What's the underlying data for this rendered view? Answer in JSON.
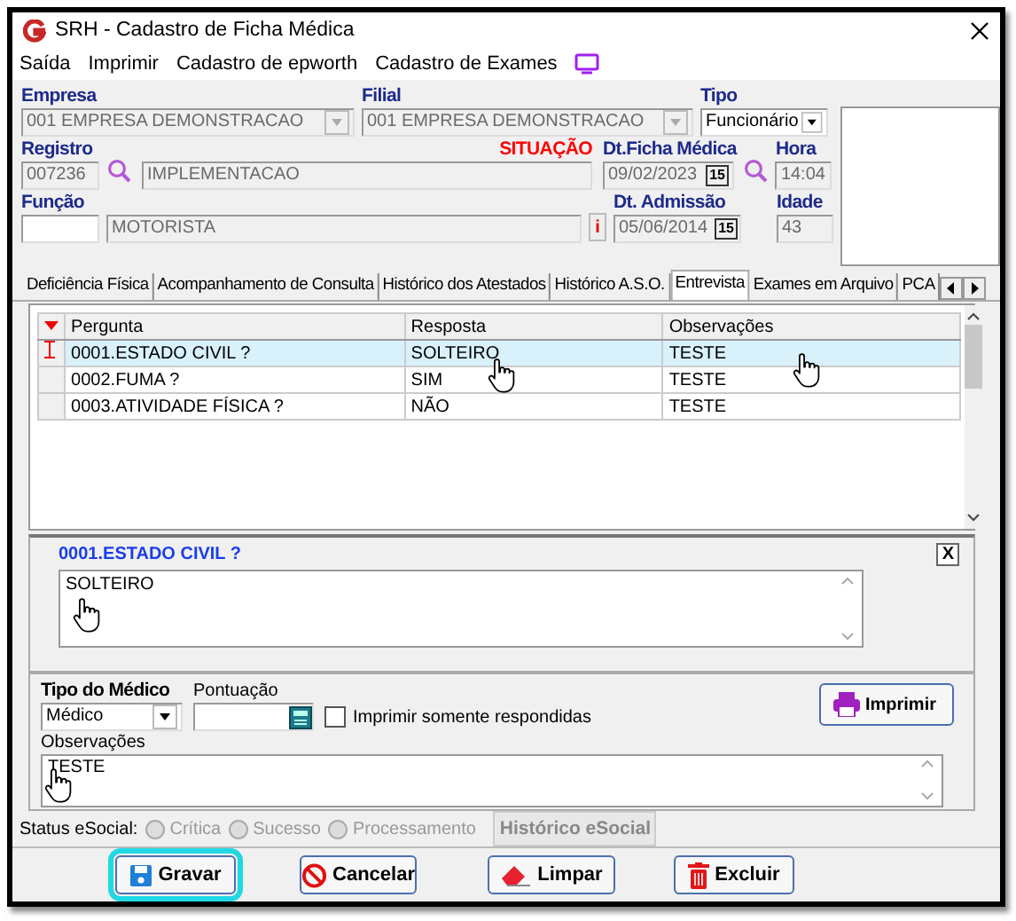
{
  "window": {
    "title": "SRH - Cadastro de Ficha Médica"
  },
  "menu": [
    "Saída",
    "Imprimir",
    "Cadastro de epworth",
    "Cadastro de Exames"
  ],
  "form": {
    "empresa": {
      "label": "Empresa",
      "value": "001 EMPRESA DEMONSTRACAO",
      "disabled": true
    },
    "filial": {
      "label": "Filial",
      "value": "001 EMPRESA DEMONSTRACAO",
      "disabled": true
    },
    "tipo": {
      "label": "Tipo",
      "value": "Funcionário",
      "disabled": false
    },
    "registro": {
      "label": "Registro",
      "value": "007236",
      "name": "IMPLEMENTACAO"
    },
    "situacao": "SITUAÇÃO",
    "dt_ficha": {
      "label": "Dt.Ficha Médica",
      "value": "09/02/2023",
      "button": "15"
    },
    "hora": {
      "label": "Hora",
      "value": "14:04"
    },
    "funcao": {
      "label": "Função",
      "description": "MOTORISTA",
      "info": "i"
    },
    "dt_admissao": {
      "label": "Dt. Admissão",
      "value": "05/06/2014",
      "button": "15"
    },
    "idade": {
      "label": "Idade",
      "value": "43"
    }
  },
  "tabs": [
    {
      "label": "Deficiência Física",
      "selected": false
    },
    {
      "label": "Acompanhamento de Consulta",
      "selected": false
    },
    {
      "label": "Histórico dos Atestados",
      "selected": false
    },
    {
      "label": "Histórico A.S.O.",
      "selected": false
    },
    {
      "label": "Entrevista",
      "selected": true
    },
    {
      "label": "Exames em Arquivo",
      "selected": false
    },
    {
      "label": "PCA",
      "selected": false
    }
  ],
  "table": {
    "columns": [
      "Pergunta",
      "Resposta",
      "Observações"
    ],
    "rows": [
      {
        "cells": [
          "0001.ESTADO CIVIL ?",
          "SOLTEIRO",
          "TESTE"
        ],
        "selected": true
      },
      {
        "cells": [
          "0002.FUMA ?",
          "SIM",
          "TESTE"
        ],
        "selected": false
      },
      {
        "cells": [
          "0003.ATIVIDADE FÍSICA ?",
          "NÃO",
          "TESTE"
        ],
        "selected": false
      }
    ]
  },
  "detail": {
    "question": "0001.ESTADO CIVIL ?",
    "close": "X",
    "answer": "SOLTEIRO"
  },
  "options": {
    "tipo_medico": {
      "label": "Tipo do Médico",
      "value": "Médico"
    },
    "pontuacao": {
      "label": "Pontuação"
    },
    "only_answered": {
      "label": "Imprimir somente respondidas",
      "checked": false
    },
    "print": "Imprimir",
    "observacoes": {
      "label": "Observações",
      "value": "TESTE"
    }
  },
  "status": {
    "label": "Status eSocial:",
    "radios": [
      {
        "label": "Crítica",
        "selected": false,
        "disabled": true
      },
      {
        "label": "Sucesso",
        "selected": false,
        "disabled": true
      },
      {
        "label": "Processamento",
        "selected": false,
        "disabled": true
      }
    ],
    "history": {
      "label": "Histórico eSocial",
      "disabled": true
    }
  },
  "buttons": [
    {
      "label": "Gravar",
      "kind": "save",
      "focused": true
    },
    {
      "label": "Cancelar",
      "kind": "cancel",
      "focused": false
    },
    {
      "label": "Limpar",
      "kind": "clear",
      "focused": false
    },
    {
      "label": "Excluir",
      "kind": "delete",
      "focused": false
    }
  ]
}
